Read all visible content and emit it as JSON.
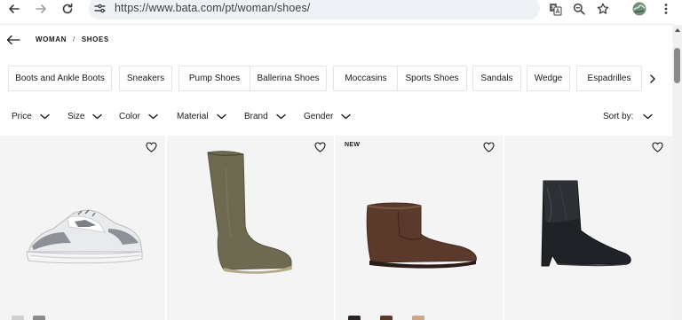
{
  "browser": {
    "url": "https://www.bata.com/pt/woman/shoes/"
  },
  "breadcrumb": {
    "items": [
      "WOMAN",
      "SHOES"
    ],
    "separator": "/"
  },
  "categories": [
    "Boots and Ankle Boots",
    "Sneakers",
    "Pump Shoes",
    "Ballerina Shoes",
    "Moccasins",
    "Sports Shoes",
    "Sandals",
    "Wedge",
    "Espadrilles"
  ],
  "filters": [
    "Price",
    "Size",
    "Color",
    "Material",
    "Brand",
    "Gender"
  ],
  "sort": {
    "label": "Sort by:"
  },
  "products": [
    {
      "badge": "",
      "image": "grey-white-sneaker",
      "colors": [
        "#cfcfcf",
        "#8a8a8a"
      ]
    },
    {
      "badge": "",
      "image": "olive-suede-knee-boot",
      "colors": []
    },
    {
      "badge": "NEW",
      "image": "brown-shearling-ankle-boot",
      "colors": [
        "#2b2623",
        "#5a3a2a",
        "#c9a98a"
      ]
    },
    {
      "badge": "",
      "image": "black-leather-wedge-boot",
      "colors": []
    }
  ],
  "icons": {
    "back": "arrow-left-icon",
    "forward": "arrow-right-icon",
    "reload": "reload-icon",
    "site-settings": "tune-icon",
    "translate": "translate-icon",
    "zoom": "zoom-icon",
    "bookmark": "star-icon",
    "profile": "avatar",
    "menu": "kebab-menu-icon",
    "wishlist": "heart-icon",
    "dropdown": "chevron-down-icon",
    "scroll-chips": "chevron-right-icon"
  }
}
